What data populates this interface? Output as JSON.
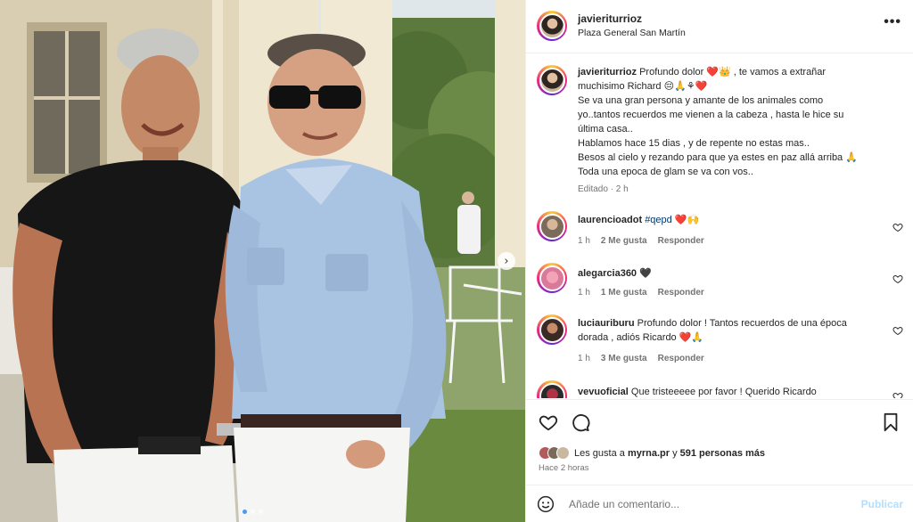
{
  "photo": {
    "carousel_next": "›",
    "dots": [
      true,
      false,
      false
    ],
    "colors": {
      "sky": "#dfe7ea",
      "foliage": "#5d7a3e",
      "column": "#efe6cf",
      "black_shirt": "#161616",
      "blue_shirt": "#a9c3e2",
      "white_pants": "#f4f4f2"
    }
  },
  "header": {
    "username": "javieriturrioz",
    "location": "Plaza General San Martín",
    "more_label": "•••"
  },
  "caption": {
    "username": "javieriturrioz",
    "lines": [
      "Profundo dolor ❤️👑 , te vamos a extrañar",
      "muchisimo Richard 😔🙏⚘❤️",
      "Se va una gran persona y amante de los animales como",
      "yo..tantos recuerdos me vienen a la cabeza , hasta le hice su",
      "última casa..",
      "Hablamos hace 15 dias , y de repente no estas mas..",
      "Besos al cielo y rezando para que ya estes en paz allá arriba 🙏",
      "Toda una epoca de glam se va con vos.."
    ],
    "edited": "Editado · 2 h"
  },
  "comments": [
    {
      "username": "laurencioadot",
      "text_tag": "#qepd",
      "text": " ❤️🙌",
      "time": "1 h",
      "likes": "2 Me gusta",
      "reply": "Responder"
    },
    {
      "username": "alegarcia360",
      "text": "🖤",
      "time": "1 h",
      "likes": "1 Me gusta",
      "reply": "Responder"
    },
    {
      "username": "luciauriburu",
      "text": "Profundo dolor ! Tantos recuerdos de una época",
      "text2": "dorada , adiós Ricardo ❤️🙏",
      "time": "1 h",
      "likes": "3 Me gusta",
      "reply": "Responder"
    },
    {
      "username": "vevuoficial",
      "text": "Que tristeeeee por favor ! Querido Ricardo"
    }
  ],
  "likes": {
    "prefix": "Les gusta a ",
    "user": "myrna.pr",
    "middle": " y ",
    "count": "591 personas más",
    "time_ago": "Hace 2 horas"
  },
  "comment_box": {
    "placeholder": "Añade un comentario...",
    "post_label": "Publicar"
  }
}
